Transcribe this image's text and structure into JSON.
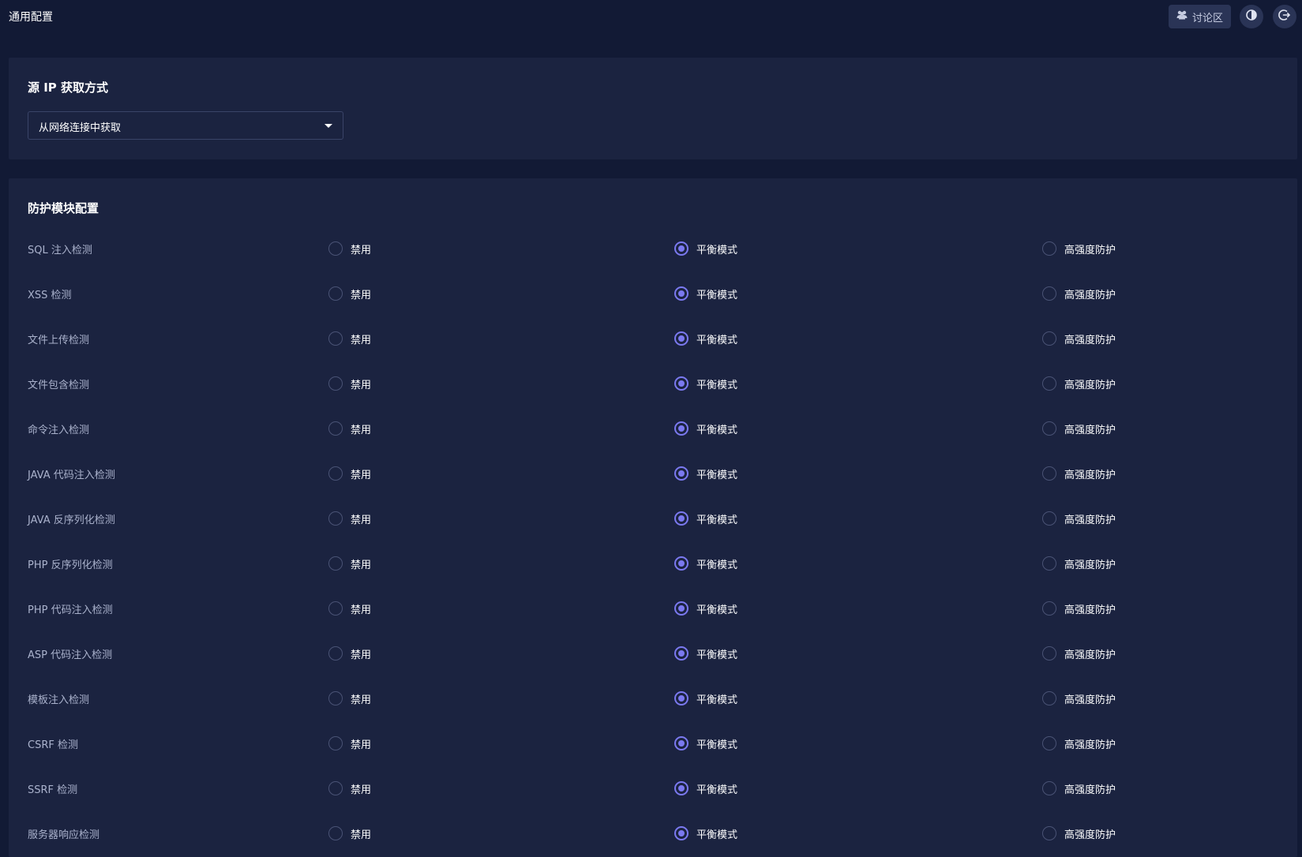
{
  "header": {
    "title": "通用配置",
    "discuss_label": "讨论区",
    "discuss_icon": "users-icon",
    "theme_icon": "theme-toggle-icon",
    "logout_icon": "logout-icon"
  },
  "source_ip": {
    "title": "源 IP 获取方式",
    "selected": "从网络连接中获取"
  },
  "protection": {
    "title": "防护模块配置",
    "option_labels": [
      "禁用",
      "平衡模式",
      "高强度防护"
    ],
    "rows": [
      {
        "label": "SQL 注入检测",
        "selected": 1
      },
      {
        "label": "XSS 检测",
        "selected": 1
      },
      {
        "label": "文件上传检测",
        "selected": 1
      },
      {
        "label": "文件包含检测",
        "selected": 1
      },
      {
        "label": "命令注入检测",
        "selected": 1
      },
      {
        "label": "JAVA 代码注入检测",
        "selected": 1
      },
      {
        "label": "JAVA 反序列化检测",
        "selected": 1
      },
      {
        "label": "PHP 反序列化检测",
        "selected": 1
      },
      {
        "label": "PHP 代码注入检测",
        "selected": 1
      },
      {
        "label": "ASP 代码注入检测",
        "selected": 1
      },
      {
        "label": "模板注入检测",
        "selected": 1
      },
      {
        "label": "CSRF 检测",
        "selected": 1
      },
      {
        "label": "SSRF 检测",
        "selected": 1
      },
      {
        "label": "服务器响应检测",
        "selected": 1
      }
    ]
  },
  "colors": {
    "accent": "#7b79f0",
    "background": "#121a35",
    "card": "#1b2340"
  }
}
